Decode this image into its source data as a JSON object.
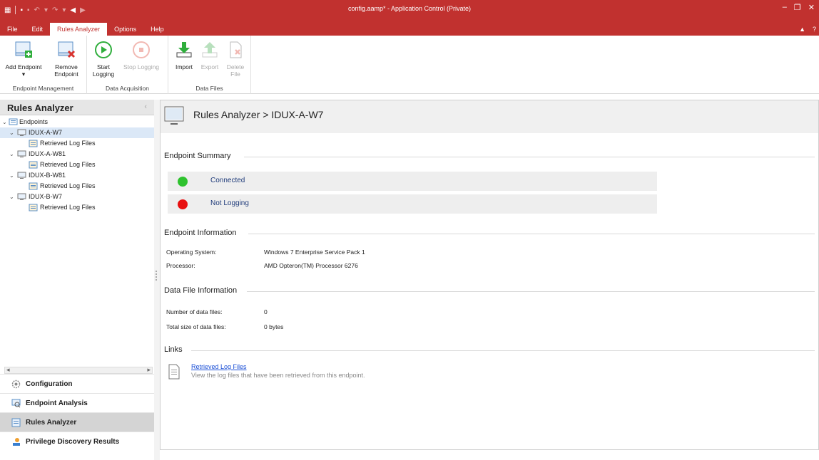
{
  "window": {
    "title": "config.aamp* - Application Control (Private)"
  },
  "menu": {
    "tabs": [
      "File",
      "Edit",
      "Rules Analyzer",
      "Options",
      "Help"
    ],
    "active": "Rules Analyzer"
  },
  "ribbon": {
    "groups": [
      {
        "name": "Endpoint Management",
        "buttons": [
          {
            "label1": "Add Endpoint",
            "label2": "▾",
            "icon": "add-endpoint-icon",
            "enabled": true
          },
          {
            "label1": "Remove",
            "label2": "Endpoint",
            "icon": "remove-endpoint-icon",
            "enabled": true
          }
        ]
      },
      {
        "name": "Data Acquisition",
        "buttons": [
          {
            "label1": "Start",
            "label2": "Logging",
            "icon": "play-icon",
            "enabled": true
          },
          {
            "label1": "Stop Logging",
            "label2": "",
            "icon": "stop-icon",
            "enabled": false
          }
        ]
      },
      {
        "name": "Data Files",
        "buttons": [
          {
            "label1": "Import",
            "label2": "",
            "icon": "import-icon",
            "enabled": true
          },
          {
            "label1": "Export",
            "label2": "",
            "icon": "export-icon",
            "enabled": false
          },
          {
            "label1": "Delete",
            "label2": "File",
            "icon": "delete-file-icon",
            "enabled": false
          }
        ]
      }
    ]
  },
  "left_pane": {
    "title": "Rules Analyzer",
    "tree": {
      "root": "Endpoints",
      "endpoints": [
        {
          "name": "IDUX-A-W7",
          "child": "Retrieved Log Files",
          "selected": true
        },
        {
          "name": "IDUX-A-W81",
          "child": "Retrieved Log Files",
          "selected": false
        },
        {
          "name": "IDUX-B-W81",
          "child": "Retrieved Log Files",
          "selected": false
        },
        {
          "name": "IDUX-B-W7",
          "child": "Retrieved Log Files",
          "selected": false
        }
      ]
    },
    "nav": [
      {
        "label": "Configuration",
        "icon": "gear-icon",
        "active": false
      },
      {
        "label": "Endpoint Analysis",
        "icon": "endpoint-analysis-icon",
        "active": false
      },
      {
        "label": "Rules Analyzer",
        "icon": "rules-analyzer-icon",
        "active": true
      },
      {
        "label": "Privilege Discovery Results",
        "icon": "privilege-discovery-icon",
        "active": false
      }
    ]
  },
  "main": {
    "breadcrumb": "Rules Analyzer > IDUX-A-W7",
    "summary": {
      "heading": "Endpoint Summary",
      "connection": "Connected",
      "logging": "Not Logging",
      "colors": {
        "connected": "#2ec22e",
        "not_logging": "#e81010"
      }
    },
    "info": {
      "heading": "Endpoint Information",
      "os_label": "Operating System:",
      "os_value": "Windows 7 Enterprise Service Pack 1",
      "proc_label": "Processor:",
      "proc_value": "AMD Opteron(TM) Processor 6276"
    },
    "data_files": {
      "heading": "Data File Information",
      "count_label": "Number of data files:",
      "count_value": "0",
      "size_label": "Total size of data files:",
      "size_value": "0 bytes"
    },
    "links": {
      "heading": "Links",
      "link_text": "Retrieved Log Files",
      "link_desc": "View the log files that have been retrieved from this endpoint."
    }
  },
  "theme": {
    "accent": "#c1312f"
  }
}
